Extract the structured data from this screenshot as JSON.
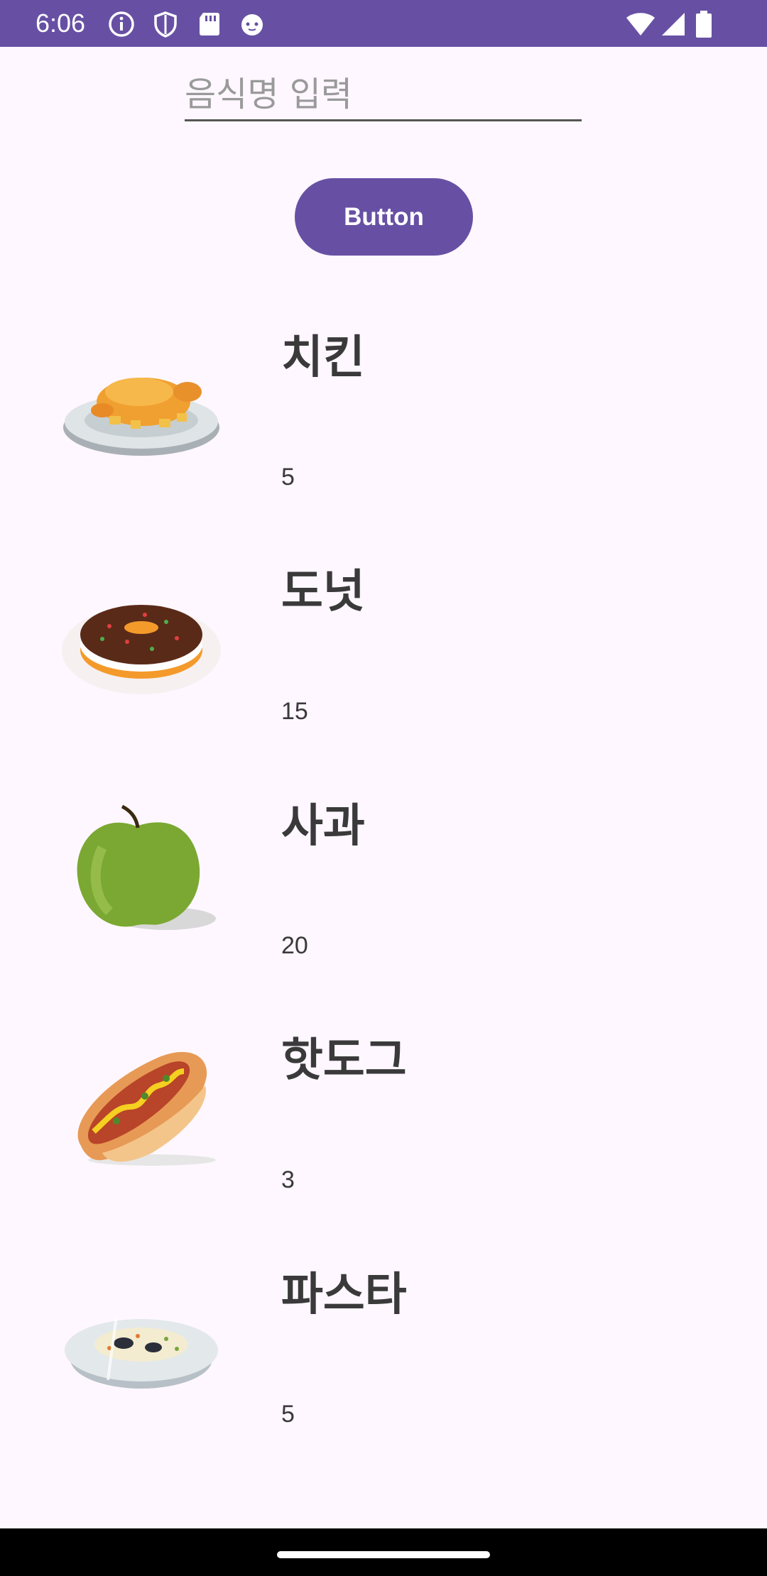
{
  "status_bar": {
    "time": "6:06",
    "left_icons": [
      "info-icon",
      "shield-icon",
      "sd-card-icon",
      "cat-face-icon"
    ],
    "right_icons": [
      "wifi-icon",
      "signal-icon",
      "battery-icon"
    ],
    "color": "#6750a4"
  },
  "search": {
    "placeholder": "음식명 입력",
    "value": ""
  },
  "button": {
    "label": "Button",
    "color": "#6750a4"
  },
  "foods": [
    {
      "name": "치킨",
      "count": "5",
      "icon": "roast-chicken-icon"
    },
    {
      "name": "도넛",
      "count": "15",
      "icon": "donut-icon"
    },
    {
      "name": "사과",
      "count": "20",
      "icon": "green-apple-icon"
    },
    {
      "name": "핫도그",
      "count": "3",
      "icon": "hotdog-icon"
    },
    {
      "name": "파스타",
      "count": "5",
      "icon": "pasta-bowl-icon"
    }
  ]
}
